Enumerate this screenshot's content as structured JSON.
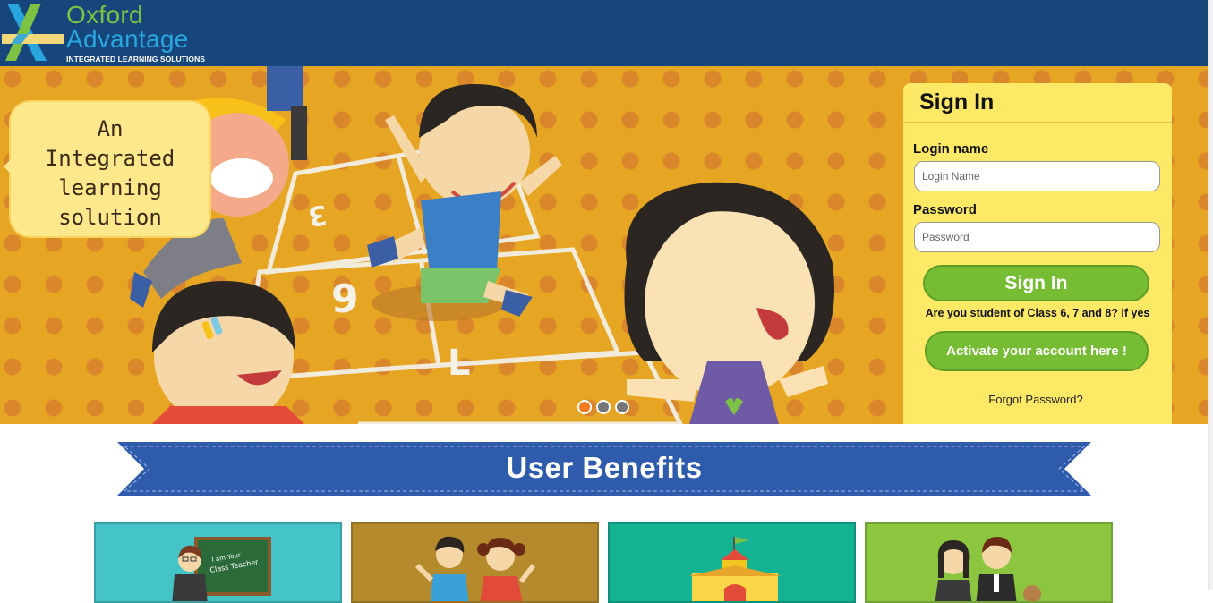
{
  "brand": {
    "name_line1": "Oxford",
    "name_line2": "Advantage",
    "tagline": "INTEGRATED LEARNING SOLUTIONS",
    "colors": {
      "header": "#16467c",
      "green": "#7dc242",
      "blue": "#29a6de"
    }
  },
  "hero": {
    "bubble_lines": [
      "An",
      "Integrated",
      "learning",
      "solution"
    ],
    "slides": [
      {
        "active": true
      },
      {
        "active": false
      },
      {
        "active": false
      }
    ]
  },
  "signin": {
    "title": "Sign In",
    "login_label": "Login name",
    "login_placeholder": "Login Name",
    "password_label": "Password",
    "password_placeholder": "Password",
    "submit_label": "Sign In",
    "student_question": "Are you student of Class 6, 7 and 8? if yes",
    "activate_label": "Activate your account here !",
    "forgot_label": "Forgot Password?",
    "colors": {
      "panel": "#fde965",
      "button": "#76bd34"
    }
  },
  "benefits": {
    "title": "User Benefits",
    "cards": [
      {
        "icon": "teacher-icon",
        "board_text_1": "I am Your",
        "board_text_2": "Class Teacher",
        "color": "#45c4c8"
      },
      {
        "icon": "students-icon",
        "color": "#b58a2c"
      },
      {
        "icon": "school-icon",
        "color": "#14b394"
      },
      {
        "icon": "parents-icon",
        "color": "#8cc63f"
      }
    ]
  }
}
